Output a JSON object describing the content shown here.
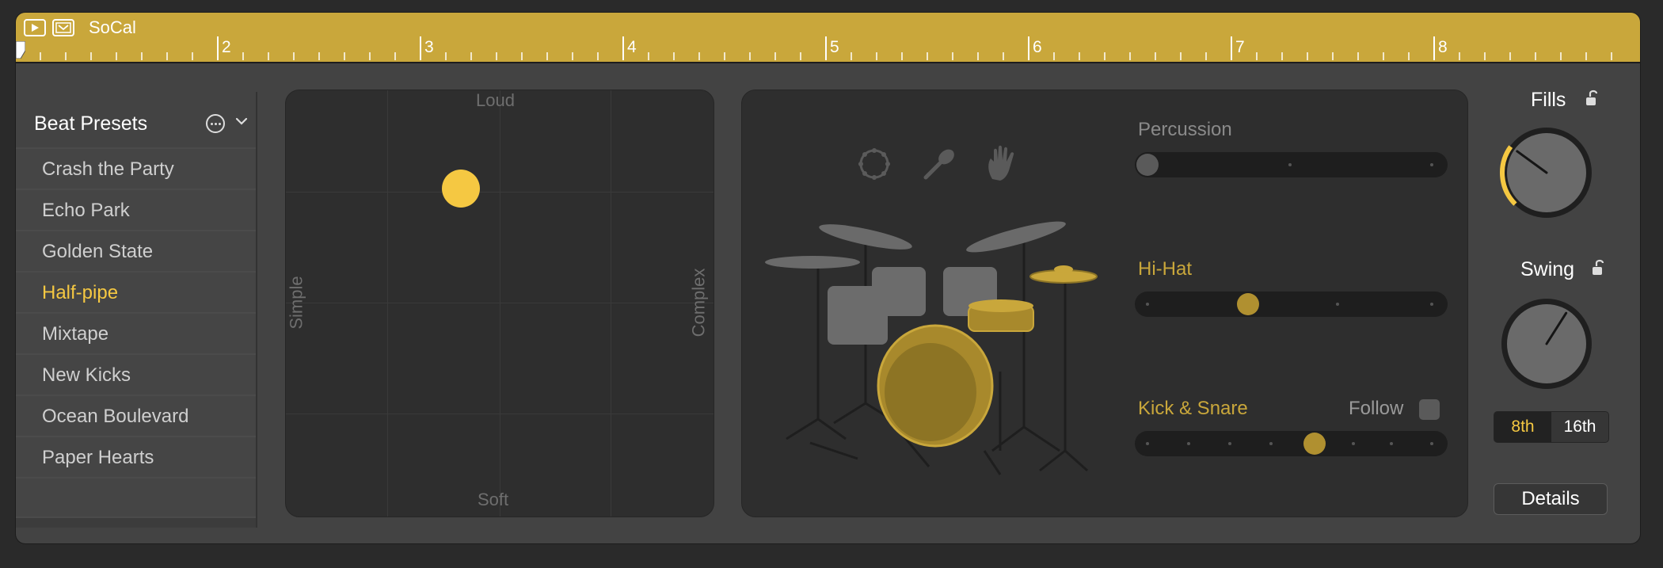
{
  "region": {
    "name": "SoCal",
    "bar_numbers": [
      "2",
      "3",
      "4",
      "5",
      "6",
      "7",
      "8"
    ]
  },
  "presets": {
    "title": "Beat Presets",
    "items": [
      {
        "label": "Crash the Party",
        "selected": false
      },
      {
        "label": "Echo Park",
        "selected": false
      },
      {
        "label": "Golden State",
        "selected": false
      },
      {
        "label": "Half-pipe",
        "selected": true
      },
      {
        "label": "Mixtape",
        "selected": false
      },
      {
        "label": "New Kicks",
        "selected": false
      },
      {
        "label": "Ocean Boulevard",
        "selected": false
      },
      {
        "label": "Paper Hearts",
        "selected": false
      }
    ]
  },
  "xy_pad": {
    "top_label": "Loud",
    "bottom_label": "Soft",
    "left_label": "Simple",
    "right_label": "Complex",
    "puck": {
      "complexity": 0.41,
      "loudness": 0.77
    },
    "puck_color": "#f5c842"
  },
  "drum_kit": {
    "instrument_icons": [
      "tambourine-icon",
      "shaker-icon",
      "handclap-icon"
    ],
    "percussion": {
      "label": "Percussion",
      "value": 0.0,
      "active": false
    },
    "hihat": {
      "label": "Hi-Hat",
      "value": 0.35,
      "active": true
    },
    "kick_snare": {
      "label": "Kick & Snare",
      "value": 0.58,
      "active": true
    },
    "follow_label": "Follow",
    "accent_color": "#c9a73b",
    "inactive_color": "#8a8a8a"
  },
  "fills": {
    "label": "Fills",
    "value": 0.3
  },
  "swing": {
    "label": "Swing",
    "value": 0.62
  },
  "note_resolution": {
    "options": [
      "8th",
      "16th"
    ],
    "selected": "8th"
  },
  "details_label": "Details"
}
